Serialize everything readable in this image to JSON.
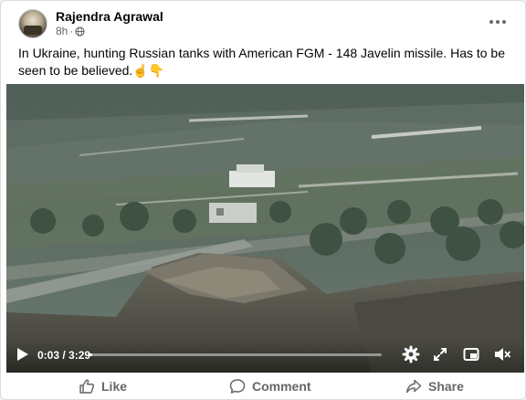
{
  "post": {
    "author": "Rajendra Agrawal",
    "timestamp": "8h",
    "audience_icon": "globe-icon",
    "more_icon": "more-horizontal-icon",
    "caption": "In Ukraine, hunting Russian tanks with American FGM - 148 Javelin missile. Has to be seen to be believed.☝️👇"
  },
  "video": {
    "current_time": "0:03",
    "duration": "3:29",
    "time_display": "0:03 / 3:29",
    "progress": 0.015,
    "controls": [
      "play-icon",
      "settings-icon",
      "fullscreen-icon",
      "picture-in-picture-icon",
      "volume-muted-icon"
    ]
  },
  "actions": {
    "like": "Like",
    "comment": "Comment",
    "share": "Share"
  },
  "colors": {
    "secondary_text": "#65676b",
    "primary_text": "#050505",
    "card_bg": "#ffffff"
  }
}
